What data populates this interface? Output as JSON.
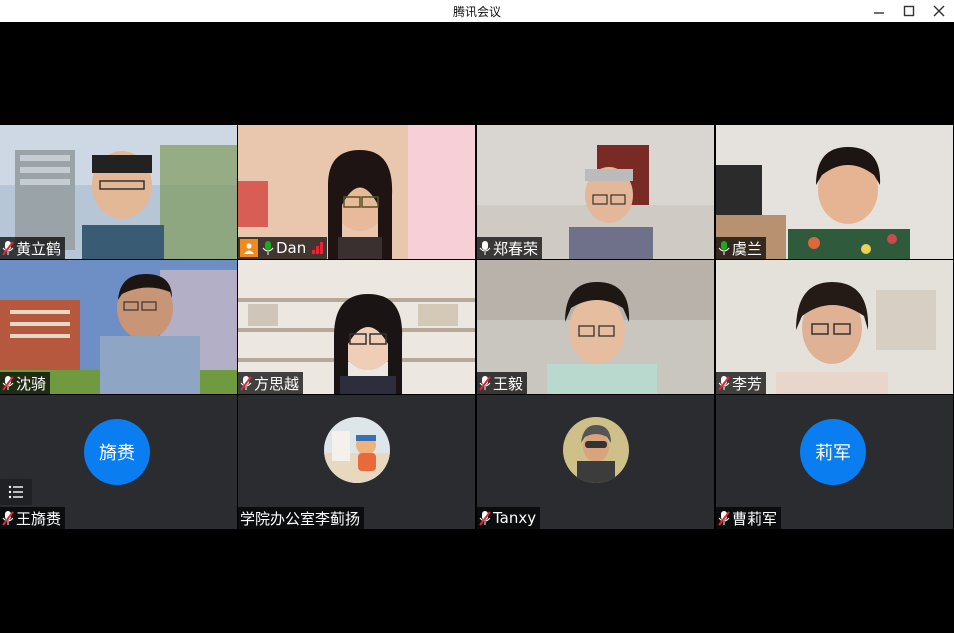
{
  "window": {
    "title": "腾讯会议"
  },
  "participants": [
    {
      "name": "黄立鹤",
      "mic": "muted"
    },
    {
      "name": "Dan",
      "mic": "active"
    },
    {
      "name": "郑春荣",
      "mic": "on"
    },
    {
      "name": "虞兰",
      "mic": "active"
    },
    {
      "name": "沈骑",
      "mic": "muted"
    },
    {
      "name": "方思越",
      "mic": "muted"
    },
    {
      "name": "王毅",
      "mic": "muted"
    },
    {
      "name": "李芳",
      "mic": "muted"
    },
    {
      "name": "王旖赉",
      "mic": "muted",
      "avatar_text": "旖赉"
    },
    {
      "name": "学院办公室李蓟扬",
      "mic": "none"
    },
    {
      "name": "Tanxy",
      "mic": "muted"
    },
    {
      "name": "曹莉军",
      "mic": "muted",
      "avatar_text": "莉军"
    }
  ],
  "colors": {
    "avatar_blue": "#0a7df0",
    "mic_active": "#1aad19",
    "mic_muted": "#e0282e",
    "bg": "#000000"
  }
}
